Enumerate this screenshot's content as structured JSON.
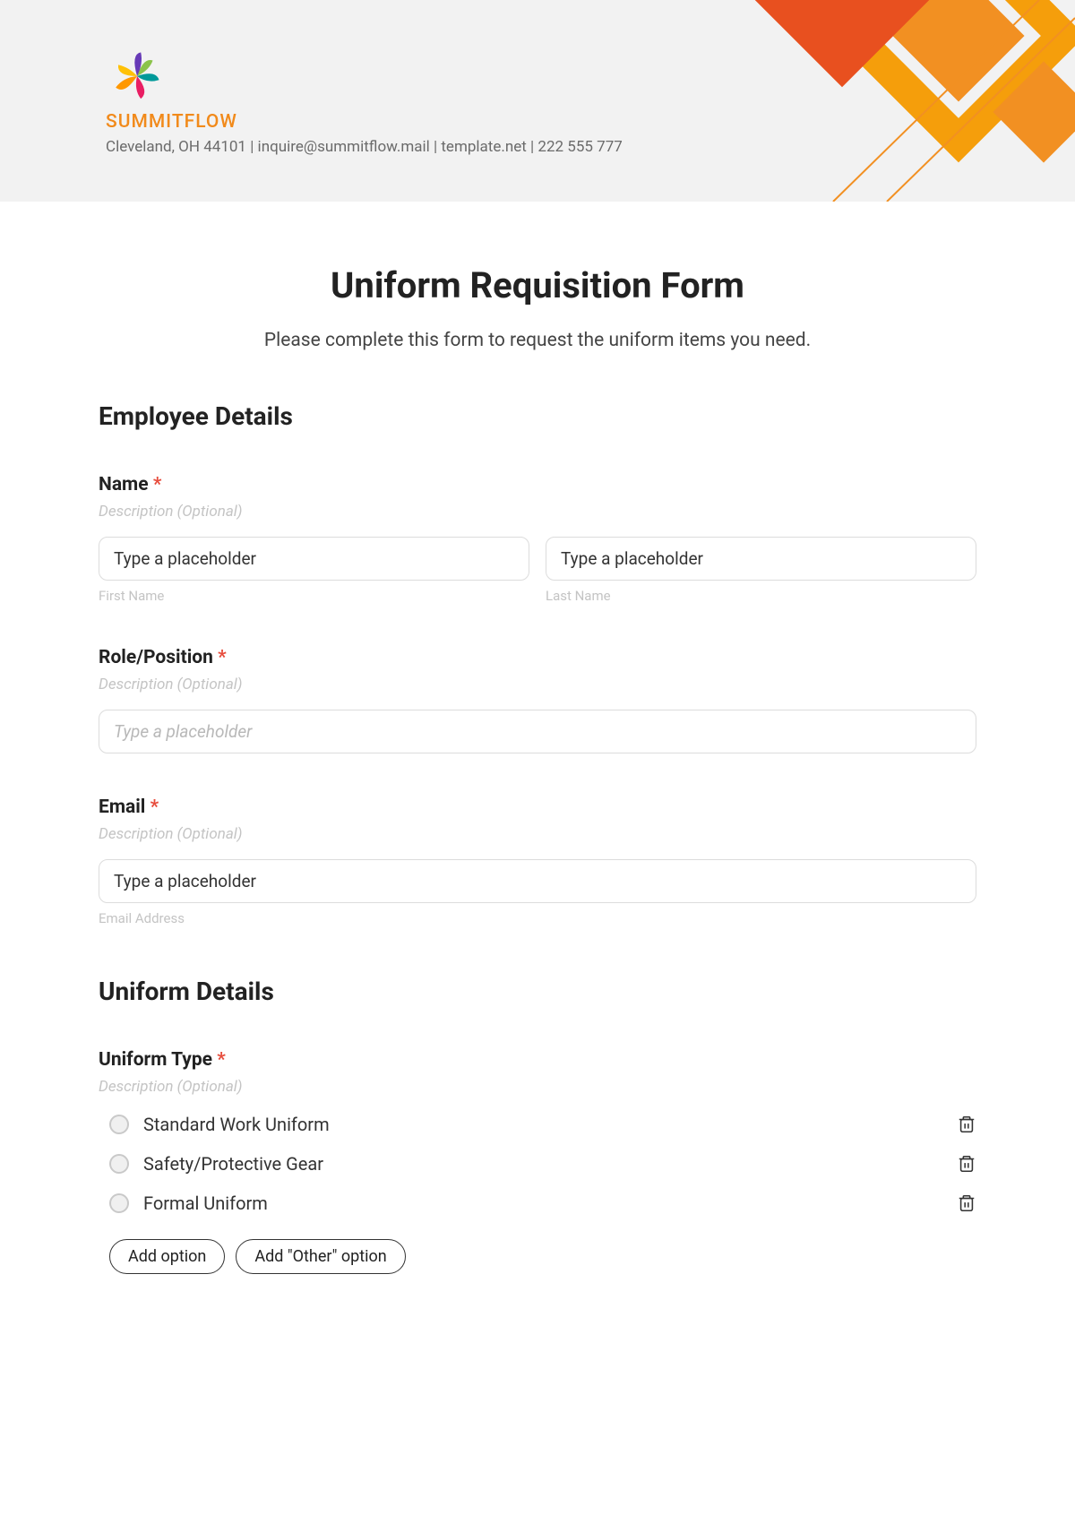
{
  "header": {
    "company_name": "SUMMITFLOW",
    "company_details": "Cleveland, OH 44101 | inquire@summitflow.mail | template.net | 222 555 777"
  },
  "form": {
    "title": "Uniform Requisition Form",
    "subtitle": "Please complete this form to request the uniform items you need."
  },
  "sections": {
    "employee_details": "Employee Details",
    "uniform_details": "Uniform Details"
  },
  "fields": {
    "name": {
      "label": "Name",
      "required": "*",
      "desc": "Description (Optional)",
      "first_placeholder": "Type a placeholder",
      "first_sublabel": "First Name",
      "last_placeholder": "Type a placeholder",
      "last_sublabel": "Last Name"
    },
    "role": {
      "label": "Role/Position",
      "required": "*",
      "desc": "Description (Optional)",
      "placeholder": "Type a placeholder"
    },
    "email": {
      "label": "Email",
      "required": "*",
      "desc": "Description (Optional)",
      "placeholder": "Type a placeholder",
      "sublabel": "Email Address"
    },
    "uniform_type": {
      "label": "Uniform Type",
      "required": "*",
      "desc": "Description (Optional)",
      "options": [
        "Standard Work Uniform",
        "Safety/Protective Gear",
        "Formal Uniform"
      ],
      "add_option": "Add option",
      "add_other": "Add \"Other\" option"
    }
  }
}
